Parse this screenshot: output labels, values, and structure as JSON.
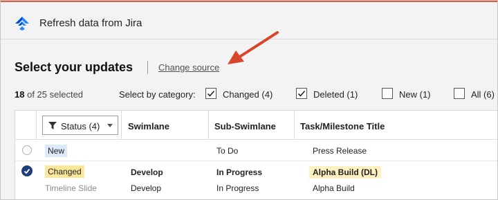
{
  "header": {
    "title": "Refresh data from Jira"
  },
  "section": {
    "title": "Select your updates",
    "change_source": "Change source"
  },
  "selection": {
    "count": "18",
    "suffix": "of 25 selected",
    "category_label": "Select by category:"
  },
  "categories": [
    {
      "label": "Changed (4)",
      "checked": true
    },
    {
      "label": "Deleted (1)",
      "checked": true
    },
    {
      "label": "New (1)",
      "checked": false
    },
    {
      "label": "All (6)",
      "checked": false
    }
  ],
  "table": {
    "status_filter": "Status (4)",
    "headers": {
      "swimlane": "Swimlane",
      "sub_swimlane": "Sub-Swimlane",
      "title": "Task/Milestone Title"
    },
    "rows": [
      {
        "selected": false,
        "status": "New",
        "swimlane": "",
        "sub_swimlane": "To Do",
        "title": "Press Release"
      },
      {
        "selected": true,
        "status": "Changed",
        "swimlane": "Develop",
        "sub_swimlane": "In Progress",
        "title": "Alpha Build (DL)"
      },
      {
        "selected": false,
        "status": "Timeline Slide",
        "swimlane": "Develop",
        "sub_swimlane": "In Progress",
        "title": "Alpha Build"
      }
    ]
  },
  "colors": {
    "accent_topline": "#e05a3a",
    "arrow": "#d9442b",
    "checked_radio": "#1f3e7a",
    "new_badge": "#dbeafb",
    "changed_badge": "#fbe79a"
  }
}
